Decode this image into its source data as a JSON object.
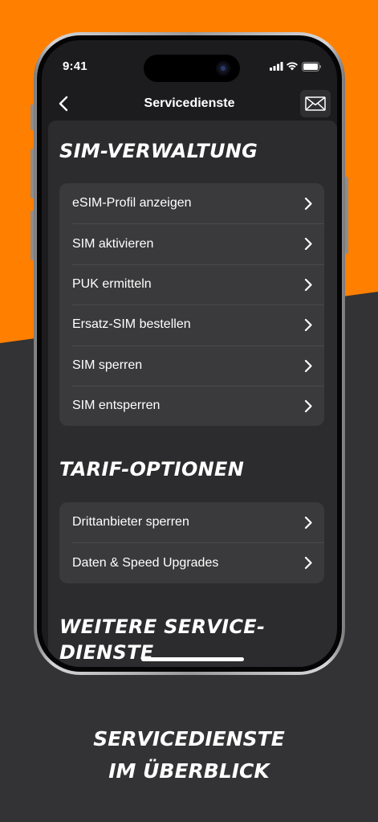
{
  "status_bar": {
    "time": "9:41"
  },
  "nav": {
    "title": "Servicedienste"
  },
  "sections": [
    {
      "title": "SIM-VERWALTUNG",
      "items": [
        {
          "label": "eSIM-Profil anzeigen"
        },
        {
          "label": "SIM aktivieren"
        },
        {
          "label": "PUK ermitteln"
        },
        {
          "label": "Ersatz-SIM bestellen"
        },
        {
          "label": "SIM sperren"
        },
        {
          "label": "SIM entsperren"
        }
      ]
    },
    {
      "title": "TARIF-OPTIONEN",
      "items": [
        {
          "label": "Drittanbieter sperren"
        },
        {
          "label": "Daten & Speed Upgrades"
        }
      ]
    },
    {
      "title": "WEITERE SERVICE-DIENSTE",
      "items": []
    }
  ],
  "caption": {
    "line1": "SERVICEDIENSTE",
    "line2": "IM ÜBERBLICK"
  },
  "colors": {
    "brand_orange": "#ff7f00",
    "background_dark": "#333335",
    "screen_bg": "#1c1c1e",
    "card_bg": "#3a3a3c"
  },
  "icons": {
    "back": "chevron-left-icon",
    "mail": "envelope-icon",
    "row_chevron": "chevron-right-icon"
  }
}
